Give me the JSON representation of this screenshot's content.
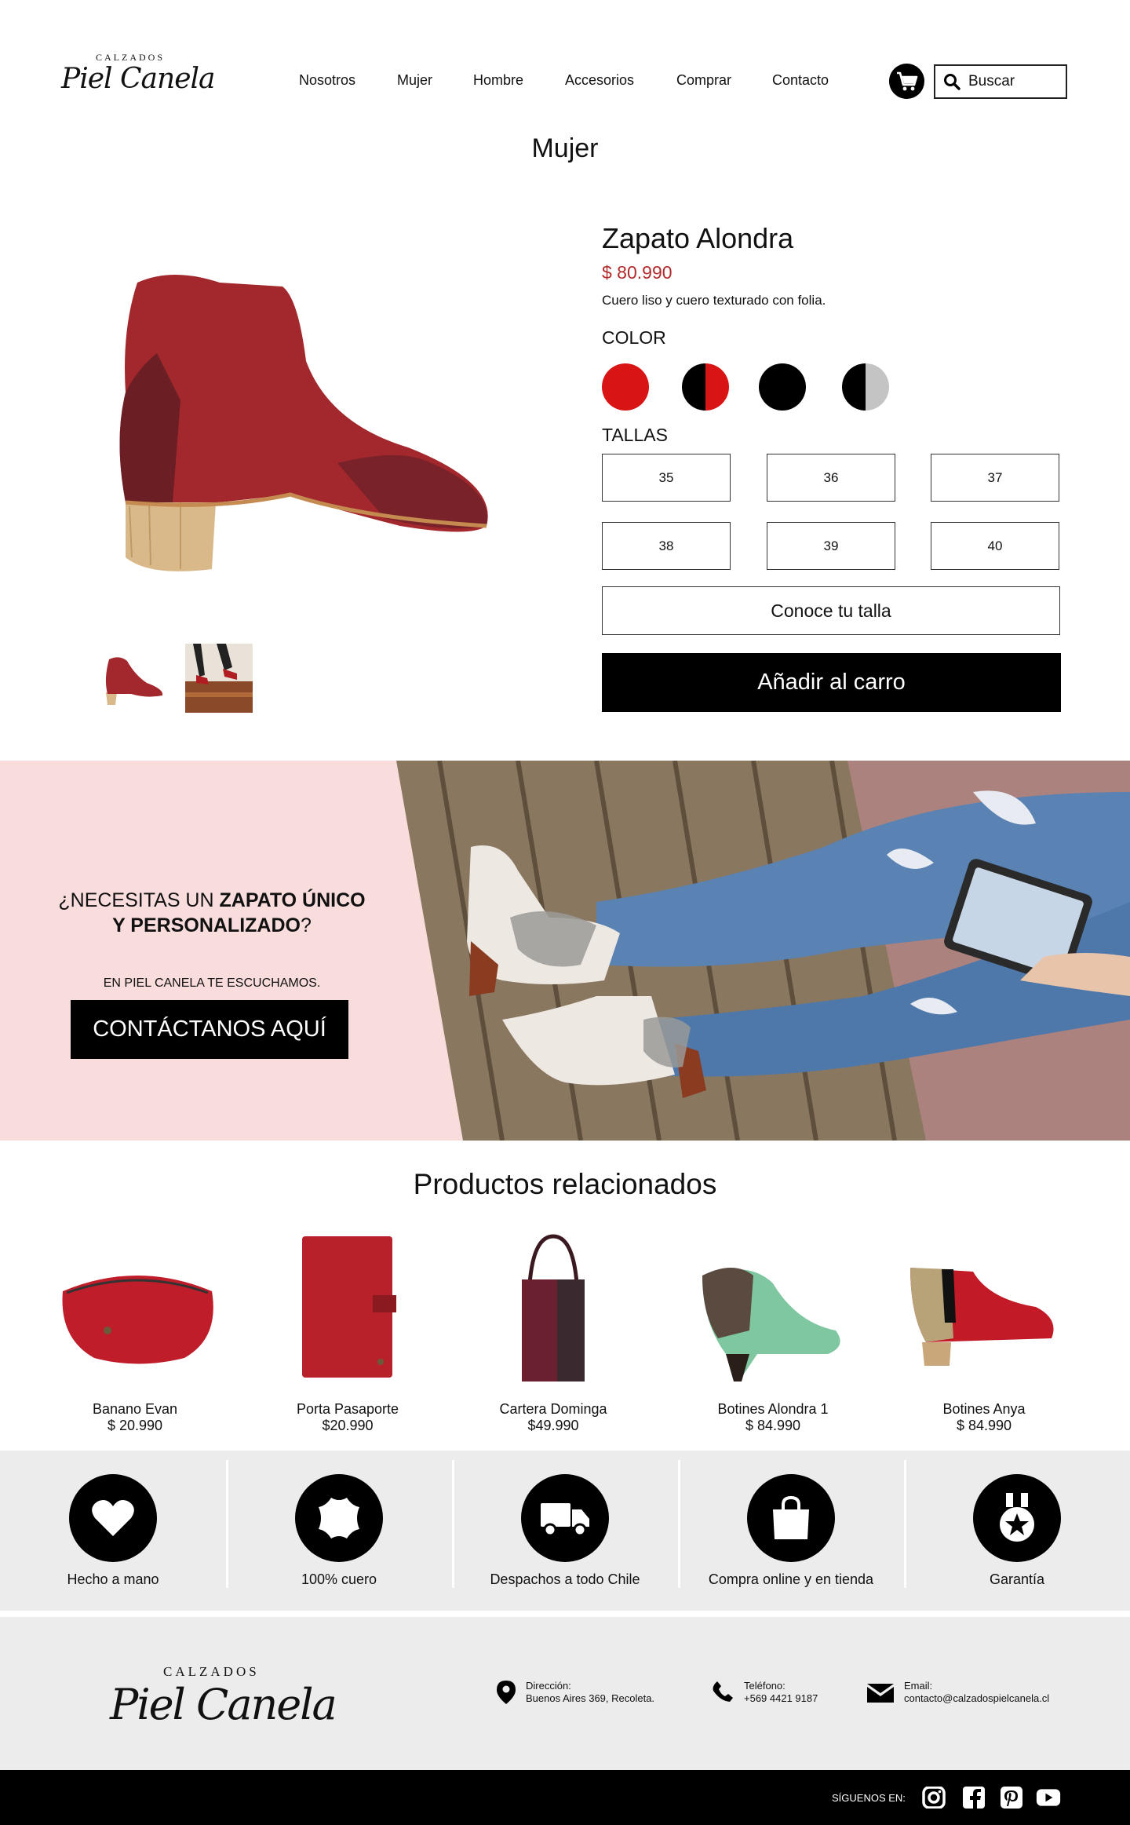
{
  "header": {
    "logo_top": "CALZADOS",
    "logo_script": "Piel Canela",
    "nav": [
      "Nosotros",
      "Mujer",
      "Hombre",
      "Accesorios",
      "Comprar",
      "Contacto"
    ],
    "search_label": "Buscar"
  },
  "page_title": "Mujer",
  "product": {
    "name": "Zapato Alondra",
    "price": "$ 80.990",
    "description": "Cuero liso y cuero texturado con folia.",
    "color_label": "COLOR",
    "colors": [
      "#d81414",
      "black-red",
      "#000000",
      "black-grey"
    ],
    "sizes_label": "TALLAS",
    "sizes": [
      "35",
      "36",
      "37",
      "38",
      "39",
      "40"
    ],
    "size_guide": "Conoce tu talla",
    "add_to_cart": "Añadir al carro",
    "accent_color": "#b22a2a"
  },
  "banner": {
    "question_pre": "¿NECESITAS UN ",
    "question_bold1": "ZAPATO ÚNICO",
    "question_bold2": "Y PERSONALIZADO",
    "question_end": "?",
    "subtitle": "EN PIEL CANELA TE ESCUCHAMOS.",
    "cta": "CONTÁCTANOS AQUÍ"
  },
  "related": {
    "title": "Productos relacionados",
    "items": [
      {
        "name": "Banano Evan",
        "price": "$ 20.990"
      },
      {
        "name": "Porta Pasaporte",
        "price": "$20.990"
      },
      {
        "name": "Cartera Dominga",
        "price": "$49.990"
      },
      {
        "name": "Botines Alondra 1",
        "price": "$ 84.990"
      },
      {
        "name": "Botines Anya",
        "price": "$ 84.990"
      }
    ]
  },
  "features": [
    {
      "label": "Hecho a mano",
      "icon": "heart-icon"
    },
    {
      "label": "100% cuero",
      "icon": "leather-icon"
    },
    {
      "label": "Despachos a todo Chile",
      "icon": "truck-icon"
    },
    {
      "label": "Compra online y en tienda",
      "icon": "bag-icon"
    },
    {
      "label": "Garantía",
      "icon": "medal-icon"
    }
  ],
  "footer": {
    "logo_top": "CALZADOS",
    "logo_script": "Piel Canela",
    "address_label": "Dirección:",
    "address": "Buenos Aires 369, Recoleta.",
    "phone_label": "Teléfono:",
    "phone": "+569 4421 9187",
    "email_label": "Email:",
    "email": "contacto@calzadospielcanela.cl",
    "follow": "SÍGUENOS EN:"
  }
}
